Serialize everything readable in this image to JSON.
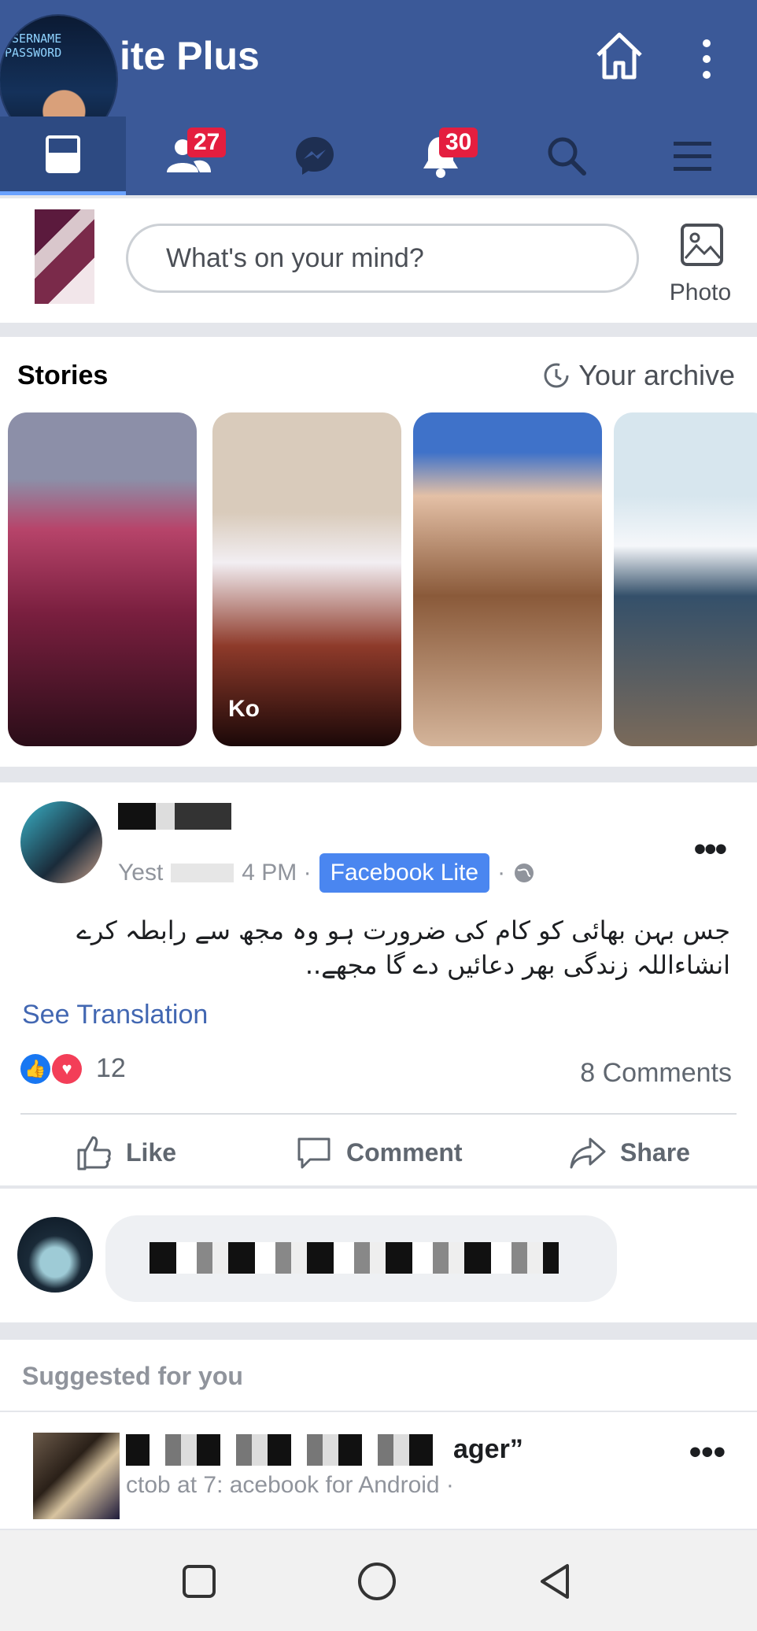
{
  "header": {
    "title": "ite Plus",
    "logo_lines": [
      "USERNAME",
      "PASSWORD"
    ],
    "icons": [
      "home-icon",
      "more-vertical-icon"
    ]
  },
  "navbar": {
    "items": [
      {
        "name": "news-feed",
        "icon": "news-feed-icon",
        "badge": null
      },
      {
        "name": "friend-requests",
        "icon": "friends-icon",
        "badge": "27"
      },
      {
        "name": "messenger",
        "icon": "messenger-icon",
        "badge": null
      },
      {
        "name": "notifications",
        "icon": "bell-icon",
        "badge": "30"
      },
      {
        "name": "search",
        "icon": "search-icon",
        "badge": null
      },
      {
        "name": "menu",
        "icon": "menu-icon",
        "badge": null
      }
    ]
  },
  "composer": {
    "placeholder": "What's on your mind?",
    "photo_label": "Photo"
  },
  "stories": {
    "title": "Stories",
    "archive_label": "Your archive",
    "labels": [
      "Ko",
      "",
      ""
    ]
  },
  "post": {
    "meta_left": "Yest",
    "meta_time": "4 PM ·",
    "app_badge": "Facebook Lite",
    "meta_dot": "·",
    "text_line1": "جس بہن بھائی کو کام کی ضرورت ہو وہ مجھ سے رابطہ کرے",
    "text_line2": "انشاءاللہ زندگی بھر دعائیں دے گا مجھے..",
    "see_translation": "See Translation",
    "reaction_count": "12",
    "comments_count": "8 Comments",
    "actions": {
      "like": "Like",
      "comment": "Comment",
      "share": "Share"
    }
  },
  "suggested": {
    "title": "Suggested for you",
    "name_fragment": "ager”",
    "meta_fragment": "ctob   at 7:     acebook for Android ·"
  },
  "colors": {
    "brand": "#3b5998",
    "badge": "#e41e3f",
    "link": "#4267b2",
    "app_badge": "#4a86f0"
  }
}
